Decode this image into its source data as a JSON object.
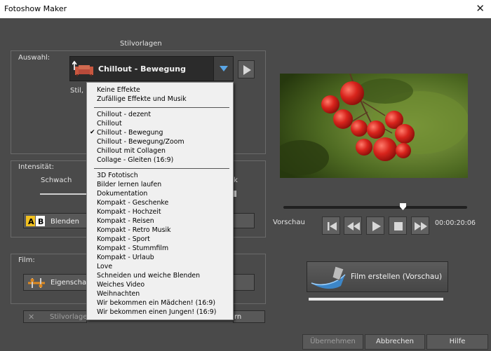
{
  "window": {
    "title": "Fotoshow Maker"
  },
  "styles_section": {
    "heading": "Stilvorlagen",
    "selection_label": "Auswahl:",
    "selected_value": "Chillout - Bewegung",
    "partial_text": "Stil, i"
  },
  "menu": {
    "group1": [
      "Keine Effekte",
      "Zufällige Effekte und Musik"
    ],
    "group2": [
      "Chillout - dezent",
      "Chillout",
      "Chillout - Bewegung",
      "Chillout - Bewegung/Zoom",
      "Chillout mit Collagen",
      "Collage - Gleiten (16:9)"
    ],
    "group3": [
      "3D Fototisch",
      "Bilder lernen laufen",
      "Dokumentation",
      "Kompakt - Geschenke",
      "Kompakt - Hochzeit",
      "Kompakt - Reisen",
      "Kompakt - Retro Musik",
      "Kompakt - Sport",
      "Kompakt - Stummfilm",
      "Kompakt - Urlaub",
      "Love",
      "Schneiden und weiche Blenden",
      "Weiches Video",
      "Weihnachten",
      "Wir bekommen ein Mädchen! (16:9)",
      "Wir bekommen einen Jungen! (16:9)"
    ],
    "checked_item": "Chillout - Bewegung"
  },
  "intensity": {
    "label": "Intensität:",
    "weak_label": "Schwach",
    "right_partial": "k"
  },
  "blend_button": {
    "label": "Blenden",
    "icon": "ab-icon"
  },
  "film": {
    "label": "Film:",
    "properties_label": "Eigenschaft"
  },
  "stylesave": {
    "label": "Stilvorlage",
    "right_partial": "rn"
  },
  "preview": {
    "label": "Vorschau",
    "time": "00:00:20:06",
    "position": 0.65
  },
  "create_button": {
    "label": "Film erstellen (Vorschau)"
  },
  "footer": {
    "apply": "Übernehmen",
    "cancel": "Abbrechen",
    "help": "Hilfe"
  },
  "colors": {
    "background": "#4a4a4a",
    "accent": "#5aa6e6",
    "menu_bg": "#f0f0f0"
  }
}
